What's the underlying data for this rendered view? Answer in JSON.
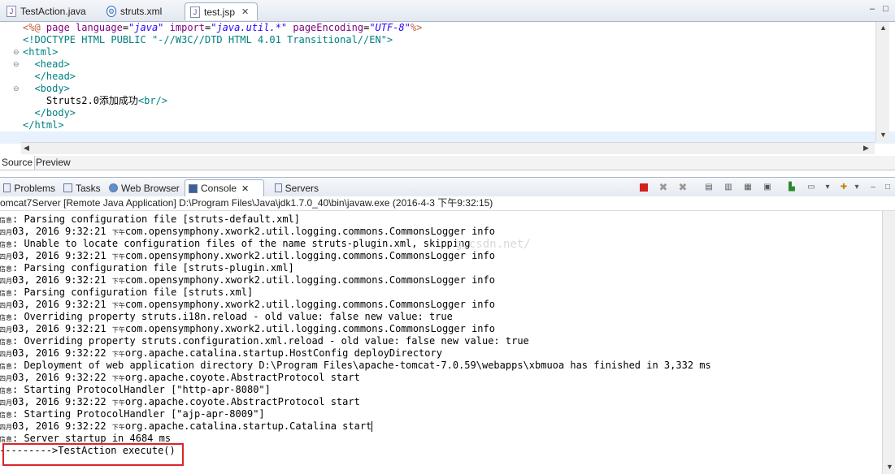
{
  "editor_tabs": [
    {
      "label": "TestAction.java",
      "icon": "java-file-icon",
      "active": false
    },
    {
      "label": "struts.xml",
      "icon": "xml-gear-icon",
      "active": false
    },
    {
      "label": "test.jsp",
      "icon": "jsp-file-icon",
      "active": true,
      "close": "✕"
    }
  ],
  "window_controls": {
    "minimize": "–",
    "maximize": "□"
  },
  "code_lines": [
    {
      "segments": [
        {
          "t": "<%@ ",
          "c": "dir"
        },
        {
          "t": "page ",
          "c": "kw"
        },
        {
          "t": "language",
          "c": "attr"
        },
        {
          "t": "=",
          "c": "plain"
        },
        {
          "t": "\"java\"",
          "c": "str"
        },
        {
          "t": " import",
          "c": "attr"
        },
        {
          "t": "=",
          "c": "plain"
        },
        {
          "t": "\"java.util.*\"",
          "c": "str"
        },
        {
          "t": " pageEncoding",
          "c": "attr"
        },
        {
          "t": "=",
          "c": "plain"
        },
        {
          "t": "\"UTF-8\"",
          "c": "str"
        },
        {
          "t": "%>",
          "c": "dir"
        }
      ]
    },
    {
      "segments": [
        {
          "t": "<!DOCTYPE HTML PUBLIC \"-//W3C//DTD HTML 4.01 Transitional//EN\">",
          "c": "dt"
        }
      ]
    },
    {
      "segments": [
        {
          "t": "<html>",
          "c": "tag"
        }
      ]
    },
    {
      "segments": [
        {
          "t": "  <head>",
          "c": "tag"
        }
      ]
    },
    {
      "segments": [
        {
          "t": "  </head>",
          "c": "tag"
        }
      ]
    },
    {
      "segments": [
        {
          "t": "  <body>",
          "c": "tag"
        }
      ]
    },
    {
      "segments": [
        {
          "t": "    Struts2.0",
          "c": "plain"
        },
        {
          "t": "添加成功",
          "c": "plain"
        },
        {
          "t": "<br/>",
          "c": "tag"
        }
      ]
    },
    {
      "segments": [
        {
          "t": "  </body>",
          "c": "tag"
        }
      ]
    },
    {
      "segments": [
        {
          "t": "</html>",
          "c": "tag"
        }
      ]
    },
    {
      "segments": [
        {
          "t": "",
          "c": "plain"
        }
      ]
    }
  ],
  "source_tabs": [
    "Source",
    "Preview"
  ],
  "view_tabs": [
    {
      "label": "Problems",
      "icon": "problems-icon",
      "active": false
    },
    {
      "label": "Tasks",
      "icon": "tasks-icon",
      "active": false
    },
    {
      "label": "Web Browser",
      "icon": "globe-icon",
      "active": false
    },
    {
      "label": "Console",
      "icon": "console-icon",
      "active": true,
      "close": "✕"
    },
    {
      "label": "Servers",
      "icon": "servers-icon",
      "active": false
    }
  ],
  "console_header": "omcat7Server [Remote Java Application] D:\\Program Files\\Java\\jdk1.7.0_40\\bin\\javaw.exe (2016-4-3 下午9:32:15)",
  "watermark": "g.csdn.net/",
  "console_lines": [
    {
      "prefix": "信息",
      "text": ": Parsing configuration file [struts-default.xml]"
    },
    {
      "prefix": "四月",
      "text": "03, 2016 9:32:21 ",
      "cjk": "下午",
      "rest": "com.opensymphony.xwork2.util.logging.commons.CommonsLogger info"
    },
    {
      "prefix": "信息",
      "text": ": Unable to locate configuration files of the name struts-plugin.xml, skipping"
    },
    {
      "prefix": "四月",
      "text": "03, 2016 9:32:21 ",
      "cjk": "下午",
      "rest": "com.opensymphony.xwork2.util.logging.commons.CommonsLogger info"
    },
    {
      "prefix": "信息",
      "text": ": Parsing configuration file [struts-plugin.xml]"
    },
    {
      "prefix": "四月",
      "text": "03, 2016 9:32:21 ",
      "cjk": "下午",
      "rest": "com.opensymphony.xwork2.util.logging.commons.CommonsLogger info"
    },
    {
      "prefix": "信息",
      "text": ": Parsing configuration file [struts.xml]"
    },
    {
      "prefix": "四月",
      "text": "03, 2016 9:32:21 ",
      "cjk": "下午",
      "rest": "com.opensymphony.xwork2.util.logging.commons.CommonsLogger info"
    },
    {
      "prefix": "信息",
      "text": ": Overriding property struts.i18n.reload - old value: false new value: true"
    },
    {
      "prefix": "四月",
      "text": "03, 2016 9:32:21 ",
      "cjk": "下午",
      "rest": "com.opensymphony.xwork2.util.logging.commons.CommonsLogger info"
    },
    {
      "prefix": "信息",
      "text": ": Overriding property struts.configuration.xml.reload - old value: false new value: true"
    },
    {
      "prefix": "四月",
      "text": "03, 2016 9:32:22 ",
      "cjk": "下午",
      "rest": "org.apache.catalina.startup.HostConfig deployDirectory"
    },
    {
      "prefix": "信息",
      "text": ": Deployment of web application directory D:\\Program Files\\apache-tomcat-7.0.59\\webapps\\xbmuoa has finished in 3,332 ms"
    },
    {
      "prefix": "四月",
      "text": "03, 2016 9:32:22 ",
      "cjk": "下午",
      "rest": "org.apache.coyote.AbstractProtocol start"
    },
    {
      "prefix": "信息",
      "text": ": Starting ProtocolHandler [\"http-apr-8080\"]"
    },
    {
      "prefix": "四月",
      "text": "03, 2016 9:32:22 ",
      "cjk": "下午",
      "rest": "org.apache.coyote.AbstractProtocol start"
    },
    {
      "prefix": "信息",
      "text": ": Starting ProtocolHandler [\"ajp-apr-8009\"]"
    },
    {
      "prefix": "四月",
      "text": "03, 2016 9:32:22 ",
      "cjk": "下午",
      "rest": "org.apache.catalina.startup.Catalina start"
    },
    {
      "prefix": "信息",
      "text": ": Server startup in 4684 ms"
    },
    {
      "prefix": "",
      "text": "--------->TestAction execute()"
    }
  ],
  "colors": {
    "highlight_box": "#d9262a",
    "terminate": "#d42020"
  }
}
